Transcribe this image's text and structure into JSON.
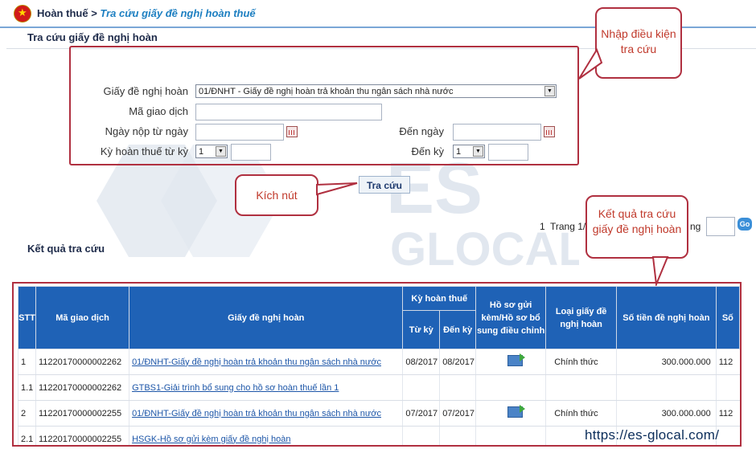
{
  "breadcrumb": {
    "root": "Hoàn thuế",
    "sep": ">",
    "current": "Tra cứu giấy đề nghị hoàn thuế"
  },
  "section_title": "Tra cứu giấy đề nghị hoàn",
  "form": {
    "doc_label": "Giấy đề nghị hoàn",
    "doc_value": "01/ĐNHT - Giấy đề nghị hoàn trả khoản thu ngân sách nhà nước",
    "txn_label": "Mã giao dịch",
    "txn_value": "",
    "date_from_label": "Ngày nộp từ ngày",
    "date_from_value": "",
    "date_to_label": "Đến ngày",
    "date_to_value": "",
    "period_from_label": "Kỳ hoàn thuế từ kỳ",
    "period_from_value": "1",
    "period_to_label": "Đến kỳ",
    "period_to_value": "1",
    "search_button": "Tra cứu"
  },
  "callouts": {
    "enter_conditions": "Nhập điều kiện tra cứu",
    "click_button": "Kích nút",
    "results_note": "Kết quả tra cứu giấy đề nghị hoàn"
  },
  "pager": {
    "page": "1",
    "trang_label": "Trang 1/",
    "tail": "ng",
    "go": "Go"
  },
  "results_title": "Kết quả tra cứu",
  "table": {
    "headers": {
      "stt": "STT",
      "ma_giao_dich": "Mã giao dịch",
      "giay": "Giấy đề nghị hoàn",
      "ky_hoan": "Kỳ hoàn thuế",
      "tu_ky": "Từ kỳ",
      "den_ky": "Đến kỳ",
      "ho_so": "Hồ sơ gửi kèm/Hồ sơ bổ sung điều chỉnh",
      "loai": "Loại giấy đề nghị hoàn",
      "so_tien": "Số tiền đề nghị hoàn",
      "cut": "Số"
    },
    "rows": [
      {
        "stt": "1",
        "ma": "11220170000002262",
        "giay": "01/ĐNHT-Giấy đề nghị hoàn trả khoản thu ngân sách nhà nước",
        "tu": "08/2017",
        "den": "08/2017",
        "loai": "Chính thức",
        "tien": "300.000.000",
        "cut": "112"
      },
      {
        "stt": "1.1",
        "ma": "11220170000002262",
        "giay": "GTBS1-Giải trình bổ sung cho hồ sơ hoàn thuế lần 1",
        "tu": "",
        "den": "",
        "loai": "",
        "tien": "",
        "cut": ""
      },
      {
        "stt": "2",
        "ma": "11220170000002255",
        "giay": "01/ĐNHT-Giấy đề nghị hoàn trả khoản thu ngân sách nhà nước",
        "tu": "07/2017",
        "den": "07/2017",
        "loai": "Chính thức",
        "tien": "300.000.000",
        "cut": "112"
      },
      {
        "stt": "2.1",
        "ma": "11220170000002255",
        "giay": "HSGK-Hồ sơ gửi kèm giấy đề nghị hoàn",
        "tu": "",
        "den": "",
        "loai": "",
        "tien": "",
        "cut": ""
      }
    ]
  },
  "watermark": {
    "line1": "ES",
    "line2": "GLOCAL"
  },
  "footer_url": "https://es-glocal.com/"
}
